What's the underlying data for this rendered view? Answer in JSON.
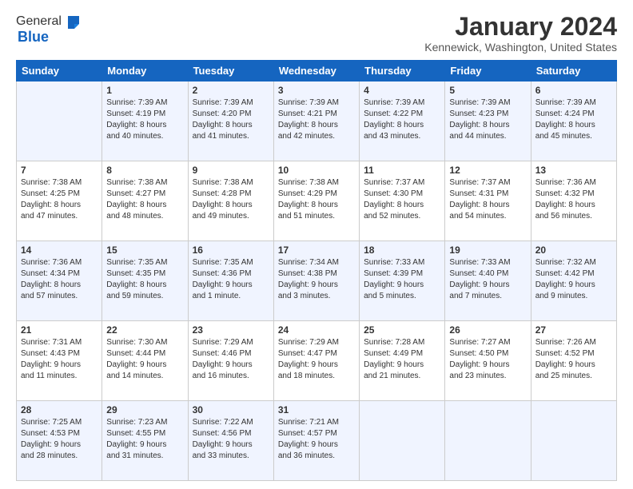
{
  "header": {
    "logo_general": "General",
    "logo_blue": "Blue",
    "month_title": "January 2024",
    "location": "Kennewick, Washington, United States"
  },
  "days_of_week": [
    "Sunday",
    "Monday",
    "Tuesday",
    "Wednesday",
    "Thursday",
    "Friday",
    "Saturday"
  ],
  "weeks": [
    [
      {
        "day": "",
        "info": ""
      },
      {
        "day": "1",
        "info": "Sunrise: 7:39 AM\nSunset: 4:19 PM\nDaylight: 8 hours\nand 40 minutes."
      },
      {
        "day": "2",
        "info": "Sunrise: 7:39 AM\nSunset: 4:20 PM\nDaylight: 8 hours\nand 41 minutes."
      },
      {
        "day": "3",
        "info": "Sunrise: 7:39 AM\nSunset: 4:21 PM\nDaylight: 8 hours\nand 42 minutes."
      },
      {
        "day": "4",
        "info": "Sunrise: 7:39 AM\nSunset: 4:22 PM\nDaylight: 8 hours\nand 43 minutes."
      },
      {
        "day": "5",
        "info": "Sunrise: 7:39 AM\nSunset: 4:23 PM\nDaylight: 8 hours\nand 44 minutes."
      },
      {
        "day": "6",
        "info": "Sunrise: 7:39 AM\nSunset: 4:24 PM\nDaylight: 8 hours\nand 45 minutes."
      }
    ],
    [
      {
        "day": "7",
        "info": "Sunrise: 7:38 AM\nSunset: 4:25 PM\nDaylight: 8 hours\nand 47 minutes."
      },
      {
        "day": "8",
        "info": "Sunrise: 7:38 AM\nSunset: 4:27 PM\nDaylight: 8 hours\nand 48 minutes."
      },
      {
        "day": "9",
        "info": "Sunrise: 7:38 AM\nSunset: 4:28 PM\nDaylight: 8 hours\nand 49 minutes."
      },
      {
        "day": "10",
        "info": "Sunrise: 7:38 AM\nSunset: 4:29 PM\nDaylight: 8 hours\nand 51 minutes."
      },
      {
        "day": "11",
        "info": "Sunrise: 7:37 AM\nSunset: 4:30 PM\nDaylight: 8 hours\nand 52 minutes."
      },
      {
        "day": "12",
        "info": "Sunrise: 7:37 AM\nSunset: 4:31 PM\nDaylight: 8 hours\nand 54 minutes."
      },
      {
        "day": "13",
        "info": "Sunrise: 7:36 AM\nSunset: 4:32 PM\nDaylight: 8 hours\nand 56 minutes."
      }
    ],
    [
      {
        "day": "14",
        "info": "Sunrise: 7:36 AM\nSunset: 4:34 PM\nDaylight: 8 hours\nand 57 minutes."
      },
      {
        "day": "15",
        "info": "Sunrise: 7:35 AM\nSunset: 4:35 PM\nDaylight: 8 hours\nand 59 minutes."
      },
      {
        "day": "16",
        "info": "Sunrise: 7:35 AM\nSunset: 4:36 PM\nDaylight: 9 hours\nand 1 minute."
      },
      {
        "day": "17",
        "info": "Sunrise: 7:34 AM\nSunset: 4:38 PM\nDaylight: 9 hours\nand 3 minutes."
      },
      {
        "day": "18",
        "info": "Sunrise: 7:33 AM\nSunset: 4:39 PM\nDaylight: 9 hours\nand 5 minutes."
      },
      {
        "day": "19",
        "info": "Sunrise: 7:33 AM\nSunset: 4:40 PM\nDaylight: 9 hours\nand 7 minutes."
      },
      {
        "day": "20",
        "info": "Sunrise: 7:32 AM\nSunset: 4:42 PM\nDaylight: 9 hours\nand 9 minutes."
      }
    ],
    [
      {
        "day": "21",
        "info": "Sunrise: 7:31 AM\nSunset: 4:43 PM\nDaylight: 9 hours\nand 11 minutes."
      },
      {
        "day": "22",
        "info": "Sunrise: 7:30 AM\nSunset: 4:44 PM\nDaylight: 9 hours\nand 14 minutes."
      },
      {
        "day": "23",
        "info": "Sunrise: 7:29 AM\nSunset: 4:46 PM\nDaylight: 9 hours\nand 16 minutes."
      },
      {
        "day": "24",
        "info": "Sunrise: 7:29 AM\nSunset: 4:47 PM\nDaylight: 9 hours\nand 18 minutes."
      },
      {
        "day": "25",
        "info": "Sunrise: 7:28 AM\nSunset: 4:49 PM\nDaylight: 9 hours\nand 21 minutes."
      },
      {
        "day": "26",
        "info": "Sunrise: 7:27 AM\nSunset: 4:50 PM\nDaylight: 9 hours\nand 23 minutes."
      },
      {
        "day": "27",
        "info": "Sunrise: 7:26 AM\nSunset: 4:52 PM\nDaylight: 9 hours\nand 25 minutes."
      }
    ],
    [
      {
        "day": "28",
        "info": "Sunrise: 7:25 AM\nSunset: 4:53 PM\nDaylight: 9 hours\nand 28 minutes."
      },
      {
        "day": "29",
        "info": "Sunrise: 7:23 AM\nSunset: 4:55 PM\nDaylight: 9 hours\nand 31 minutes."
      },
      {
        "day": "30",
        "info": "Sunrise: 7:22 AM\nSunset: 4:56 PM\nDaylight: 9 hours\nand 33 minutes."
      },
      {
        "day": "31",
        "info": "Sunrise: 7:21 AM\nSunset: 4:57 PM\nDaylight: 9 hours\nand 36 minutes."
      },
      {
        "day": "",
        "info": ""
      },
      {
        "day": "",
        "info": ""
      },
      {
        "day": "",
        "info": ""
      }
    ]
  ]
}
